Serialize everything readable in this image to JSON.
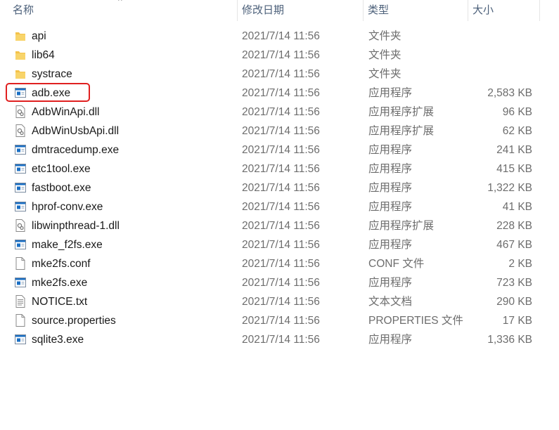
{
  "header": {
    "name": "名称",
    "date": "修改日期",
    "type": "类型",
    "size": "大小",
    "sort_glyph": "^"
  },
  "rows": [
    {
      "name": "api",
      "date": "2021/7/14 11:56",
      "type": "文件夹",
      "size": "",
      "icon": "folder-icon"
    },
    {
      "name": "lib64",
      "date": "2021/7/14 11:56",
      "type": "文件夹",
      "size": "",
      "icon": "folder-icon"
    },
    {
      "name": "systrace",
      "date": "2021/7/14 11:56",
      "type": "文件夹",
      "size": "",
      "icon": "folder-icon"
    },
    {
      "name": "adb.exe",
      "date": "2021/7/14 11:56",
      "type": "应用程序",
      "size": "2,583 KB",
      "icon": "exe-icon"
    },
    {
      "name": "AdbWinApi.dll",
      "date": "2021/7/14 11:56",
      "type": "应用程序扩展",
      "size": "96 KB",
      "icon": "dll-icon"
    },
    {
      "name": "AdbWinUsbApi.dll",
      "date": "2021/7/14 11:56",
      "type": "应用程序扩展",
      "size": "62 KB",
      "icon": "dll-icon"
    },
    {
      "name": "dmtracedump.exe",
      "date": "2021/7/14 11:56",
      "type": "应用程序",
      "size": "241 KB",
      "icon": "exe-icon"
    },
    {
      "name": "etc1tool.exe",
      "date": "2021/7/14 11:56",
      "type": "应用程序",
      "size": "415 KB",
      "icon": "exe-icon"
    },
    {
      "name": "fastboot.exe",
      "date": "2021/7/14 11:56",
      "type": "应用程序",
      "size": "1,322 KB",
      "icon": "exe-icon"
    },
    {
      "name": "hprof-conv.exe",
      "date": "2021/7/14 11:56",
      "type": "应用程序",
      "size": "41 KB",
      "icon": "exe-icon"
    },
    {
      "name": "libwinpthread-1.dll",
      "date": "2021/7/14 11:56",
      "type": "应用程序扩展",
      "size": "228 KB",
      "icon": "dll-icon"
    },
    {
      "name": "make_f2fs.exe",
      "date": "2021/7/14 11:56",
      "type": "应用程序",
      "size": "467 KB",
      "icon": "exe-icon"
    },
    {
      "name": "mke2fs.conf",
      "date": "2021/7/14 11:56",
      "type": "CONF 文件",
      "size": "2 KB",
      "icon": "file-icon"
    },
    {
      "name": "mke2fs.exe",
      "date": "2021/7/14 11:56",
      "type": "应用程序",
      "size": "723 KB",
      "icon": "exe-icon"
    },
    {
      "name": "NOTICE.txt",
      "date": "2021/7/14 11:56",
      "type": "文本文档",
      "size": "290 KB",
      "icon": "text-file-icon"
    },
    {
      "name": "source.properties",
      "date": "2021/7/14 11:56",
      "type": "PROPERTIES 文件",
      "size": "17 KB",
      "icon": "file-icon"
    },
    {
      "name": "sqlite3.exe",
      "date": "2021/7/14 11:56",
      "type": "应用程序",
      "size": "1,336 KB",
      "icon": "exe-icon"
    }
  ],
  "colors": {
    "header_text": "#4c607a",
    "highlight_border": "#e02020",
    "folder": "#f4c24a",
    "exe_accent": "#1a6fc4"
  }
}
